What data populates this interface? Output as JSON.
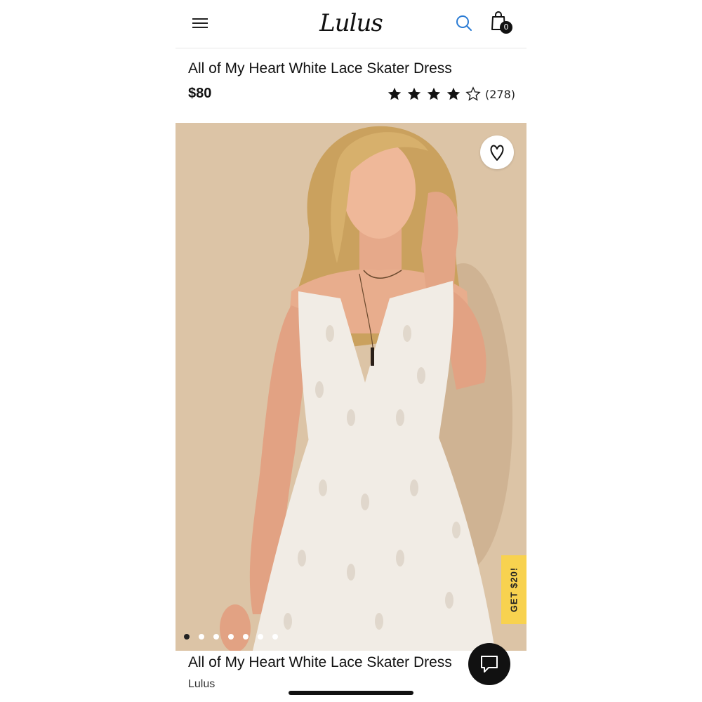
{
  "header": {
    "logo_text": "Lulus",
    "cart_count": "0",
    "search_icon": "search-icon",
    "menu_icon": "hamburger-menu-icon",
    "cart_icon": "shopping-bag-icon"
  },
  "product": {
    "title": "All of My Heart White Lace Skater Dress",
    "price": "$80",
    "rating": 4,
    "rating_max": 5,
    "review_count": "(278)"
  },
  "gallery": {
    "image_count": 7,
    "active_index": 0,
    "wishlist_icon": "heart-icon"
  },
  "promo": {
    "label": "GET $20!",
    "color": "#f8d24f"
  },
  "sticky_bar": {
    "title": "All of My Heart White Lace Skater Dress",
    "brand": "Lulus",
    "chat_icon": "chat-bubble-icon"
  },
  "colors": {
    "image_background": "#dcc4a6",
    "text": "#111111",
    "search_icon": "#2a7bd4"
  }
}
